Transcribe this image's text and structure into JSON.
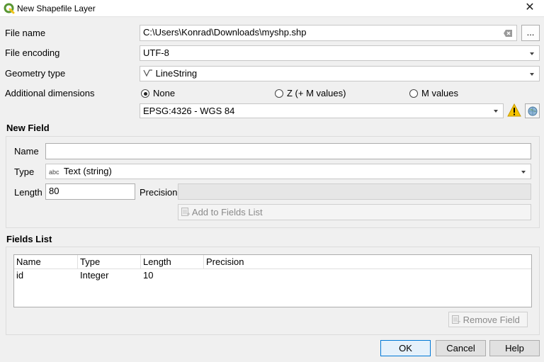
{
  "window": {
    "title": "New Shapefile Layer",
    "close_glyph": "✕"
  },
  "form": {
    "file_name_label": "File name",
    "file_name_value": "C:\\Users\\Konrad\\Downloads\\myshp.shp",
    "browse_label": "...",
    "encoding_label": "File encoding",
    "encoding_value": "UTF-8",
    "geometry_label": "Geometry type",
    "geometry_value": "LineString",
    "dimensions_label": "Additional dimensions",
    "dimension_options": [
      "None",
      "Z (+ M values)",
      "M values"
    ],
    "dimension_selected": "None",
    "crs_value": "EPSG:4326 - WGS 84"
  },
  "new_field": {
    "title": "New Field",
    "name_label": "Name",
    "name_value": "",
    "type_label": "Type",
    "type_prefix": "abc",
    "type_value": "Text (string)",
    "length_label": "Length",
    "length_value": "80",
    "precision_label": "Precision",
    "precision_value": "",
    "add_button": "Add to Fields List"
  },
  "fields_list": {
    "title": "Fields List",
    "columns": [
      "Name",
      "Type",
      "Length",
      "Precision"
    ],
    "rows": [
      {
        "name": "id",
        "type": "Integer",
        "length": "10",
        "precision": ""
      }
    ],
    "remove_button": "Remove Field"
  },
  "buttons": {
    "ok": "OK",
    "cancel": "Cancel",
    "help": "Help"
  },
  "colors": {
    "warning": "#f5c400",
    "qgis_green": "#589632",
    "accent": "#0078d7"
  }
}
